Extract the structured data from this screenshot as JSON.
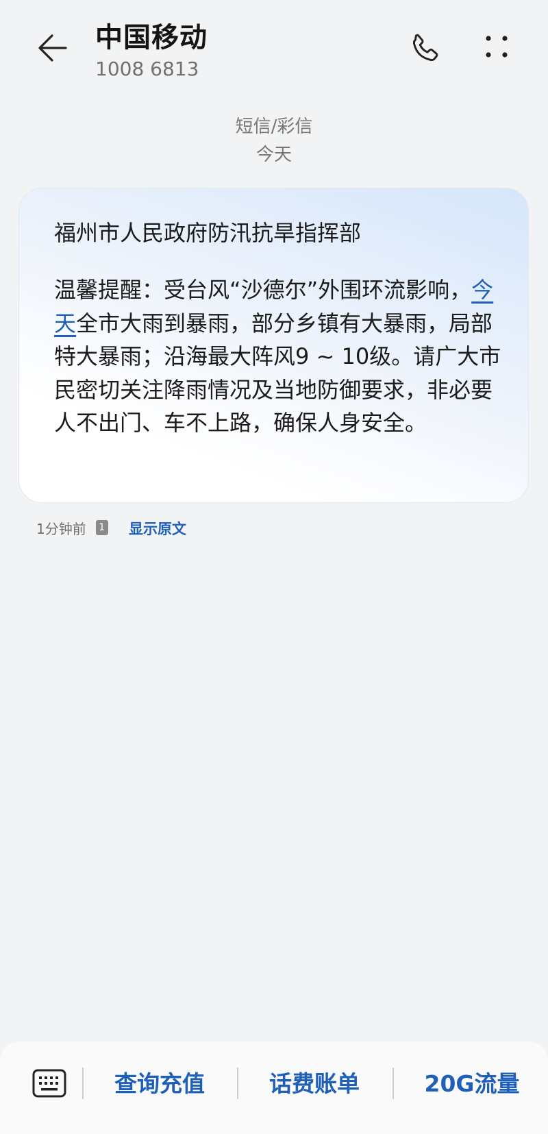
{
  "header": {
    "contact_name": "中国移动",
    "contact_number": "1008 6813"
  },
  "thread": {
    "message_type": "短信/彩信",
    "date_label": "今天"
  },
  "message": {
    "sender_line": "福州市人民政府防汛抗旱指挥部",
    "body_part1": "温馨提醒：受台风“沙德尔”外围环流影响，",
    "body_link": "今天",
    "body_part2": "全市大雨到暴雨，部分乡镇有大暴雨，局部特大暴雨；沿海最大阵风9 ~ 10级。请广大市民密切关注降雨情况及当地防御要求，非必要人不出门、车不上路，确保人身安全。",
    "time_label": "1分钟前",
    "sim_slot": "1",
    "show_original_label": "显示原文"
  },
  "quick_actions": [
    {
      "label": "查询充值"
    },
    {
      "label": "话费账单"
    },
    {
      "label": "20G流量"
    }
  ],
  "colors": {
    "accent": "#1f5fb8",
    "background": "#f1f3f5",
    "bubble_gradient_top": "#d6e6fb"
  },
  "icons": [
    "back-arrow-icon",
    "phone-icon",
    "more-vertical-icon",
    "keyboard-icon"
  ]
}
